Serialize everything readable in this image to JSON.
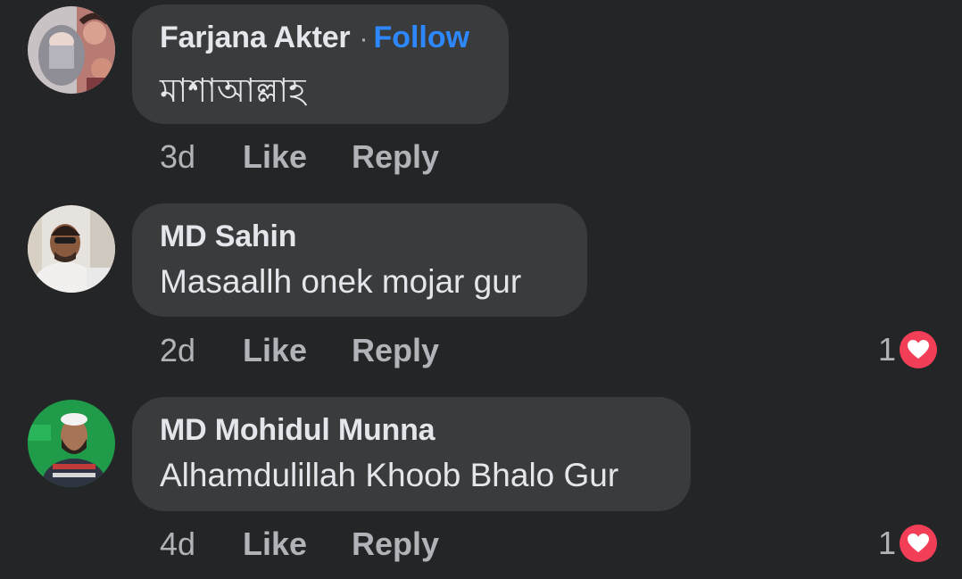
{
  "comments": [
    {
      "author": "Farjana Akter",
      "separator": "·",
      "follow_label": "Follow",
      "text": "মাশাআল্লাহ",
      "time": "3d",
      "like_label": "Like",
      "reply_label": "Reply"
    },
    {
      "author": "MD Sahin",
      "text": "Masaallh onek mojar gur",
      "time": "2d",
      "like_label": "Like",
      "reply_label": "Reply",
      "reaction_count": "1",
      "reaction_icon": "heart-icon"
    },
    {
      "author": "MD Mohidul Munna",
      "text": "Alhamdulillah Khoob Bhalo Gur",
      "time": "4d",
      "like_label": "Like",
      "reply_label": "Reply",
      "reaction_count": "1",
      "reaction_icon": "heart-icon"
    }
  ],
  "colors": {
    "background": "#242526",
    "bubble": "#3a3b3c",
    "follow": "#2d88ff",
    "heart": "#f33e58",
    "muted_text": "#b0b3b8"
  }
}
